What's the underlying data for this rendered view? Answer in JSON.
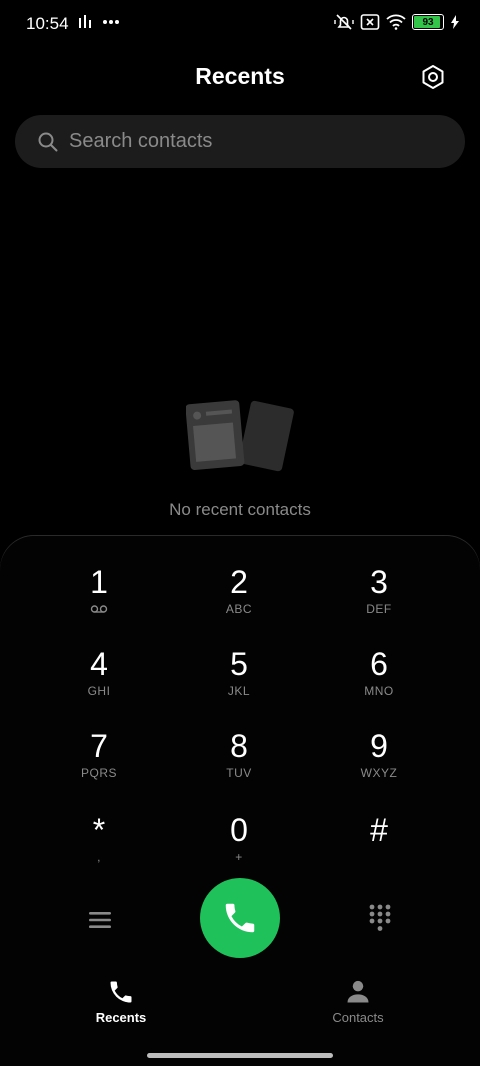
{
  "status_bar": {
    "time": "10:54",
    "battery_level": "93",
    "battery_percent": 93,
    "icons": [
      "signal-strength-icon",
      "more-dots-icon",
      "vibrate-off-icon",
      "no-sim-icon",
      "wifi-icon",
      "battery-icon",
      "charging-bolt-icon"
    ]
  },
  "header": {
    "title": "Recents",
    "settings_icon": "settings-hexagon-icon"
  },
  "search": {
    "placeholder": "Search contacts",
    "icon": "search-icon"
  },
  "empty_state": {
    "text": "No recent contacts",
    "icon": "empty-cards-illustration"
  },
  "dialpad": {
    "keys": [
      {
        "digit": "1",
        "letters": "voicemail"
      },
      {
        "digit": "2",
        "letters": "ABC"
      },
      {
        "digit": "3",
        "letters": "DEF"
      },
      {
        "digit": "4",
        "letters": "GHI"
      },
      {
        "digit": "5",
        "letters": "JKL"
      },
      {
        "digit": "6",
        "letters": "MNO"
      },
      {
        "digit": "7",
        "letters": "PQRS"
      },
      {
        "digit": "8",
        "letters": "TUV"
      },
      {
        "digit": "9",
        "letters": "WXYZ"
      },
      {
        "digit": "*",
        "letters": ","
      },
      {
        "digit": "0",
        "letters": "+"
      },
      {
        "digit": "#",
        "letters": ""
      }
    ],
    "menu_icon": "hamburger-menu-icon",
    "call_icon": "phone-icon",
    "keypad_icon": "dialpad-icon",
    "colors": {
      "call_button": "#1fc15b",
      "background": "#000000",
      "muted_text": "#8a8a8a"
    }
  },
  "bottom_nav": {
    "tabs": [
      {
        "label": "Recents",
        "icon": "phone-icon",
        "active": true
      },
      {
        "label": "Contacts",
        "icon": "person-icon",
        "active": false
      }
    ]
  }
}
